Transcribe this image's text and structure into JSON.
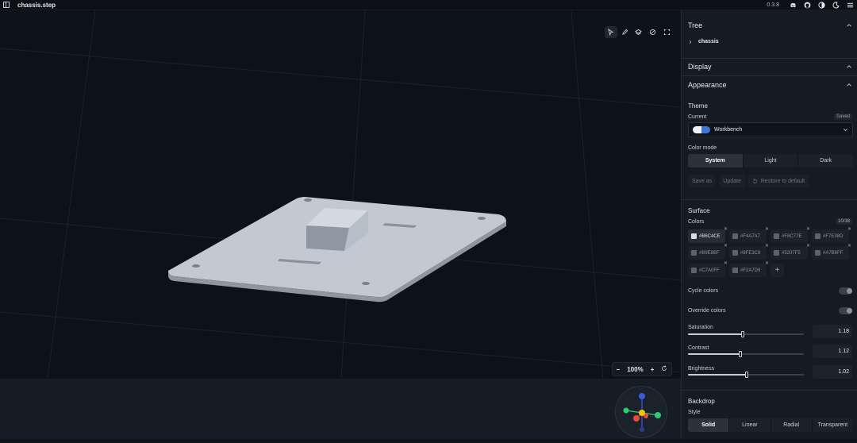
{
  "topbar": {
    "filename": "chassis.step",
    "version": "0.3.8",
    "icons": [
      "sidebar-icon",
      "discord-icon",
      "github-icon",
      "contrast-icon",
      "moon-icon",
      "menu-icon"
    ]
  },
  "viewport": {
    "tools": [
      "select-icon",
      "pen-icon",
      "layers-icon",
      "eye-off-icon",
      "fit-icon"
    ],
    "zoom": {
      "minus": "−",
      "value": "100%",
      "plus": "+",
      "reset_icon": "reset-icon"
    },
    "gizmo_colors": {
      "x": "#e74c3c",
      "y": "#2ecc71",
      "z": "#3b5bdb",
      "center": "#f1c40f"
    }
  },
  "panel": {
    "tree": {
      "title": "Tree",
      "root": "chassis"
    },
    "display": {
      "title": "Display"
    },
    "appearance": {
      "title": "Appearance",
      "theme_label": "Theme",
      "current_label": "Current",
      "saved_badge": "Saved",
      "theme_value": "Workbench",
      "color_mode_label": "Color mode",
      "color_modes": [
        "System",
        "Light",
        "Dark"
      ],
      "color_mode_selected": "System",
      "actions": [
        "Save as",
        "Update",
        "Restore to default"
      ]
    },
    "surface": {
      "title": "Surface",
      "colors_label": "Colors",
      "count_badge": "10/38",
      "colors": [
        {
          "hex": "#B6C4CE",
          "active": true
        },
        {
          "hex": "#F4A7A7",
          "active": false
        },
        {
          "hex": "#F8C77E",
          "active": false
        },
        {
          "hex": "#F7E38D",
          "active": false
        },
        {
          "hex": "#B9E8BF",
          "active": false
        },
        {
          "hex": "#8FE3C8",
          "active": false
        },
        {
          "hex": "#5207F5",
          "active": false
        },
        {
          "hex": "#A7B6FF",
          "active": false
        },
        {
          "hex": "#C7A0FF",
          "active": false
        },
        {
          "hex": "#F2A7D9",
          "active": false
        }
      ],
      "add_label": "+",
      "cycle_colors_label": "Cycle colors",
      "override_colors_label": "Override colors",
      "sliders": [
        {
          "label": "Saturation",
          "value": "1.18",
          "fraction": 0.47
        },
        {
          "label": "Contrast",
          "value": "1.12",
          "fraction": 0.45
        },
        {
          "label": "Brightness",
          "value": "1.02",
          "fraction": 0.51
        }
      ]
    },
    "backdrop": {
      "title": "Backdrop",
      "style_label": "Style",
      "styles": [
        "Solid",
        "Linear",
        "Radial",
        "Transparent"
      ],
      "style_selected": "Solid"
    }
  }
}
